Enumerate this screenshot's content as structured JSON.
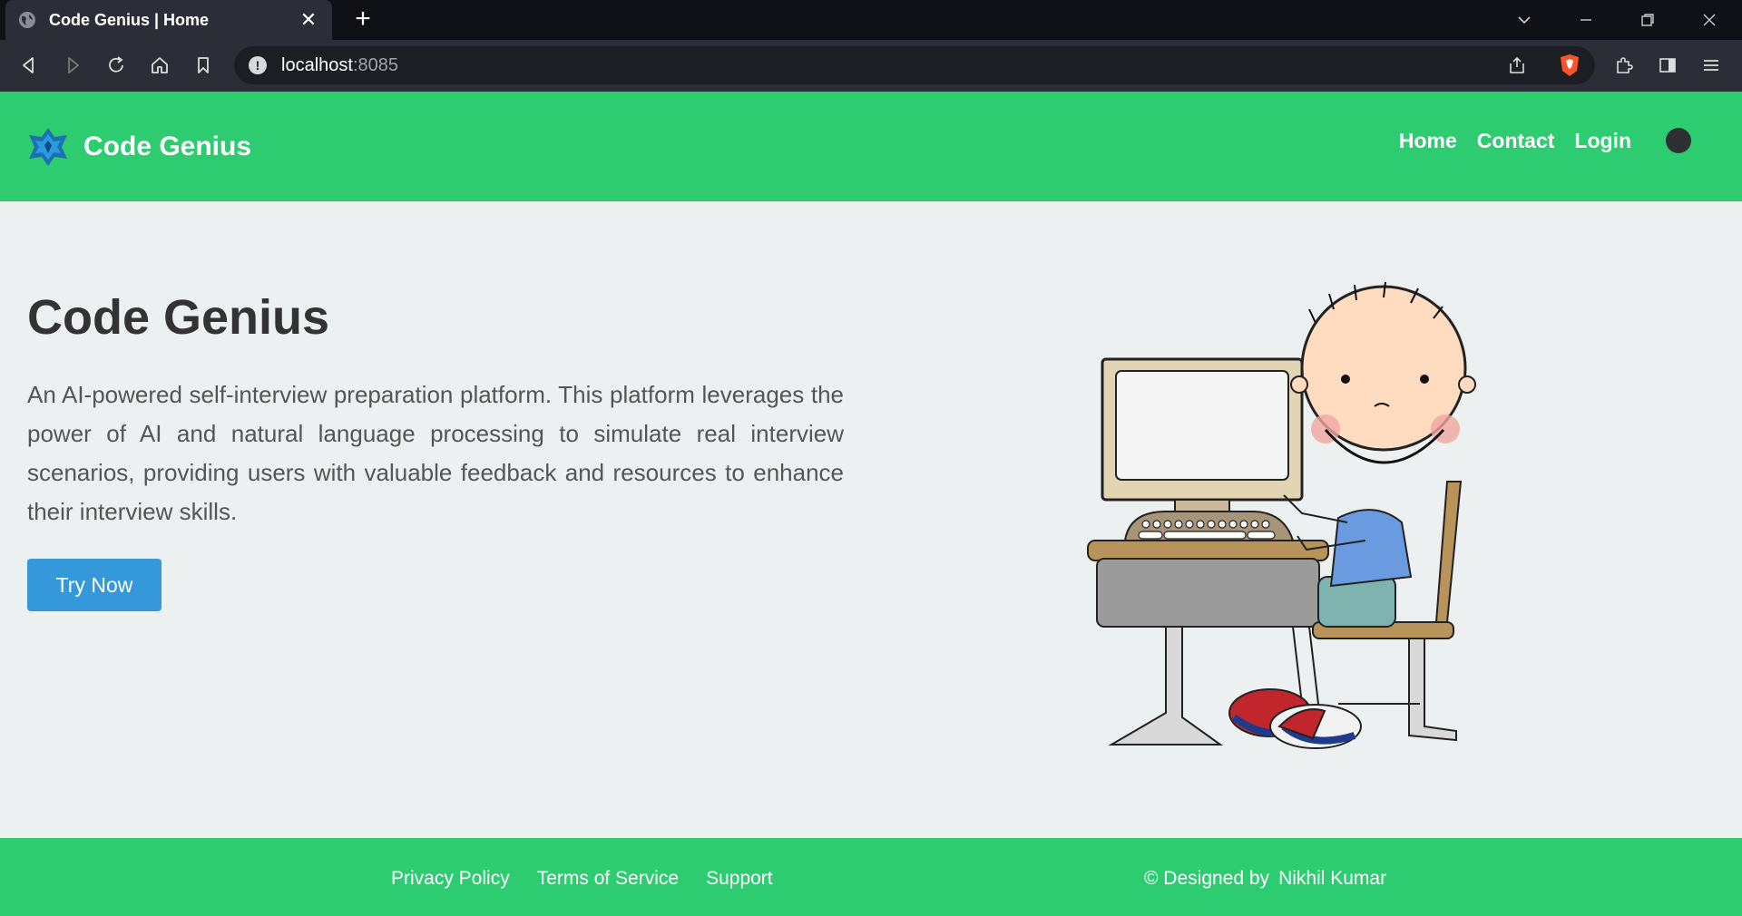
{
  "browser": {
    "tab_title": "Code Genius | Home",
    "url_host": "localhost",
    "url_port": ":8085"
  },
  "header": {
    "brand": "Code Genius",
    "nav": {
      "home": "Home",
      "contact": "Contact",
      "login": "Login"
    }
  },
  "hero": {
    "title": "Code Genius",
    "description": "An AI-powered self-interview preparation platform. This platform leverages the power of AI and natural language processing to simulate real interview scenarios, providing users with valuable feedback and resources to enhance their interview skills.",
    "cta": "Try Now"
  },
  "footer": {
    "links": {
      "privacy": "Privacy Policy",
      "terms": "Terms of Service",
      "support": "Support"
    },
    "credit_prefix": "© Designed by",
    "credit_name": "Nikhil Kumar"
  },
  "colors": {
    "primary_green": "#2ecc71",
    "button_blue": "#3498db",
    "page_bg": "#ecf0f1"
  }
}
